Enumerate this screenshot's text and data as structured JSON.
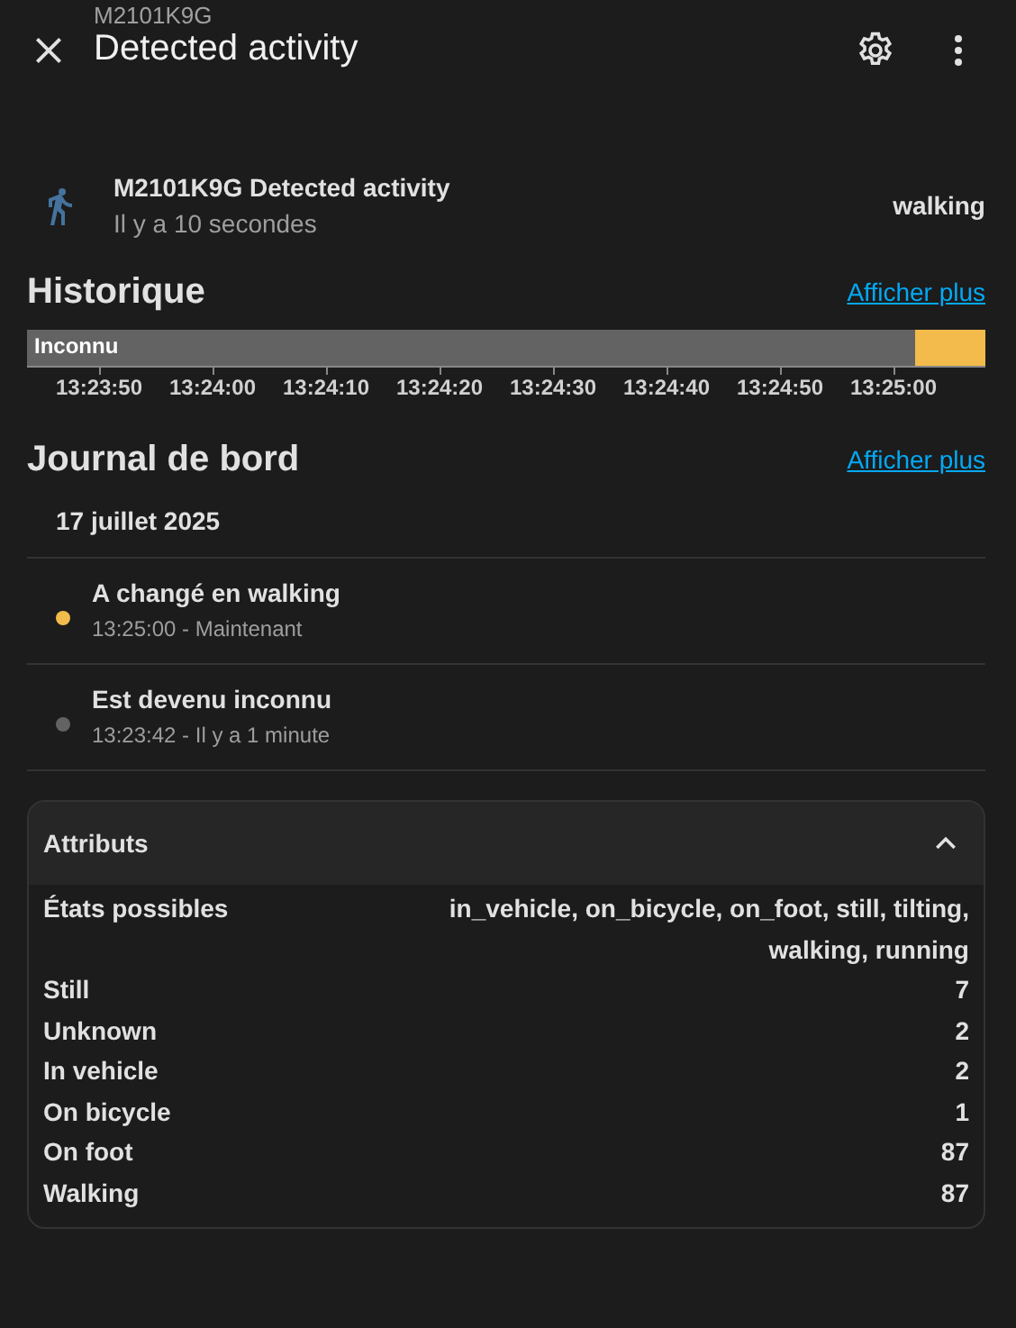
{
  "header": {
    "subtitle": "M2101K9G",
    "title": "Detected activity"
  },
  "entity": {
    "name": "M2101K9G Detected activity",
    "time": "Il y a 10 secondes",
    "state": "walking"
  },
  "history": {
    "title": "Historique",
    "more": "Afficher plus",
    "segments": [
      {
        "label": "Inconnu",
        "color": "#636363",
        "level": 0.927
      },
      {
        "color": "#f2bb4b",
        "level": 0.073
      }
    ],
    "ticks": [
      "13:23:50",
      "13:24:00",
      "13:24:10",
      "13:24:20",
      "13:24:30",
      "13:24:40",
      "13:24:50",
      "13:25:00"
    ]
  },
  "logbook": {
    "title": "Journal de bord",
    "more": "Afficher plus",
    "date": "17 juillet 2025",
    "entries": [
      {
        "message": "A changé en walking",
        "time": "13:25:00 - Maintenant",
        "color": "#f2bb4b"
      },
      {
        "message": "Est devenu inconnu",
        "time": "13:23:42 - Il y a 1 minute",
        "color": "#636363"
      }
    ]
  },
  "attributes": {
    "title": "Attributs",
    "expanded": true,
    "rows": [
      {
        "name": "États possibles",
        "value": "in_vehicle, on_bicycle, on_foot, still, tilting, walking, running"
      },
      {
        "name": "Still",
        "value": "7"
      },
      {
        "name": "Unknown",
        "value": "2"
      },
      {
        "name": "In vehicle",
        "value": "2"
      },
      {
        "name": "On bicycle",
        "value": "1"
      },
      {
        "name": "On foot",
        "value": "87"
      },
      {
        "name": "Walking",
        "value": "87"
      }
    ]
  }
}
